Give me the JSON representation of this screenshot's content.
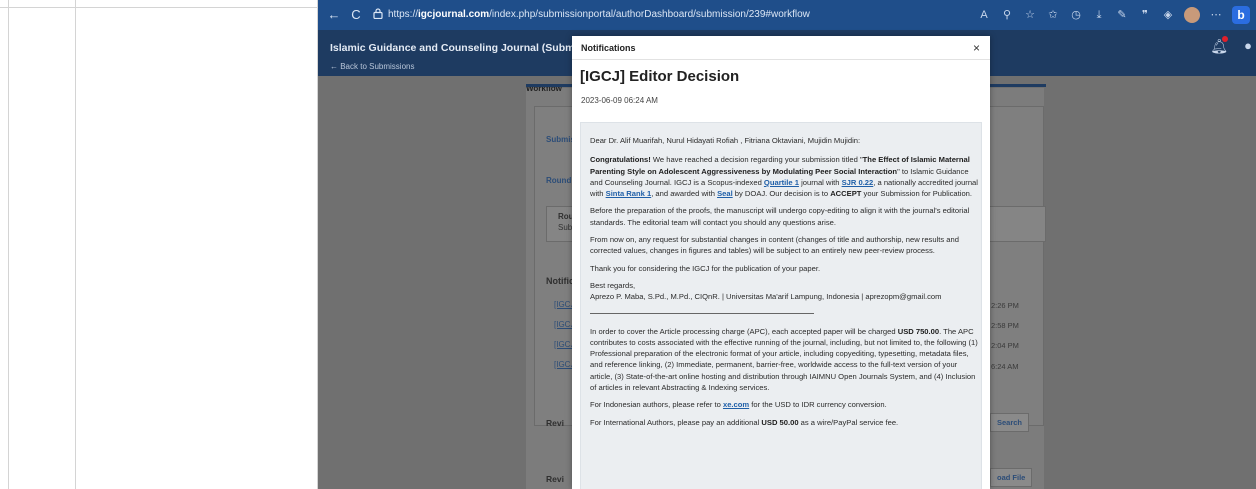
{
  "browser": {
    "url_prefix": "https://",
    "url_host": "igcjournal.com",
    "url_path": "/index.php/submissionportal/authorDashboard/submission/239#workflow",
    "back_icon": "←",
    "reload_icon": "C",
    "lock_icon": "lock-icon"
  },
  "app": {
    "title": "Islamic Guidance and Counseling Journal (Submission Portal)",
    "back_link": "← Back to Submissions",
    "bell_icon": "bell-icon",
    "user_icon": "user-icon"
  },
  "background_page": {
    "workflow_tab": "Workflow",
    "submission_frag": "Submis",
    "round_frag": "Round",
    "round_box_frag": "Rou",
    "sub_box_frag": "Sub",
    "notifications_frag": "Notific",
    "igcj_rows": [
      "[IGCJ]",
      "[IGCJ]",
      "[IGCJ]",
      "[IGCJ]"
    ],
    "times": [
      "2:26 PM",
      "2:58 PM",
      "2:04 PM",
      "6:24 AM"
    ],
    "review_frag_1": "Revi",
    "review_frag_2": "Revi",
    "search_btn": "Search",
    "upload_btn": "oad File"
  },
  "modal": {
    "header": "Notifications",
    "close": "×",
    "title": "[IGCJ] Editor Decision",
    "date": "2023-06-09 06:24 AM",
    "greeting": "Dear Dr. Alif Muarifah, Nurul Hidayati Rofiah , Fitriana Oktaviani, Mujidin Mujidin:",
    "p1": {
      "congrats": "Congratulations!",
      "a": " We have reached a decision regarding your submission titled \"",
      "paper_title": "The Effect of Islamic Maternal Parenting Style on Adolescent Aggressiveness by Modulating Peer Social Interaction",
      "b": "\" to Islamic Guidance and Counseling Journal. IGCJ is a Scopus-indexed ",
      "quartile": "Quartile 1",
      "c": " journal with ",
      "sjr": "SJR 0.22",
      "d": ", a nationally accredited journal with ",
      "sinta": "Sinta Rank 1",
      "e": ", and awarded with ",
      "seal": "Seal",
      "f": " by DOAJ. Our decision is to ",
      "accept": "ACCEPT",
      "g": " your Submission for Publication."
    },
    "p2": "Before the preparation of the proofs, the manuscript will undergo copy-editing to align it with the journal's editorial standards. The editorial team will contact you should any questions arise.",
    "p3": "From now on, any request for substantial changes in content (changes of title and authorship, new results and corrected values, changes in figures and tables) will be subject to an entirely new peer-review process.",
    "p4": "Thank you for considering the IGCJ for the publication of your paper.",
    "regards": "Best regards,",
    "signature": "Aprezo P. Maba, S.Pd., M.Pd., CIQnR. | Universitas Ma'arif Lampung, Indonesia | aprezopm@gmail.com",
    "apc": {
      "a": "In order to cover the Article processing charge (APC), each accepted paper will be charged ",
      "amount": "USD 750.00",
      "b": ". The APC contributes to costs associated with the effective running of the journal, including, but not limited to, the following (1) Professional preparation of the electronic format of your article, including copyediting, typesetting, metadata files, and reference linking, (2) Immediate, permanent, barrier-free, worldwide access to the full-text version of your article, (3) State-of-the-art online hosting and distribution through IAIMNU Open Journals System, and (4) Inclusion of articles in relevant Abstracting & Indexing services."
    },
    "idr": {
      "a": "For Indonesian authors, please refer to ",
      "link": "xe.com",
      "b": " for the USD to IDR currency conversion."
    },
    "intl": {
      "a": "For International Authors, please pay an additional ",
      "amount": "USD 50.00",
      "b": " as a wire/PayPal service fee."
    }
  }
}
